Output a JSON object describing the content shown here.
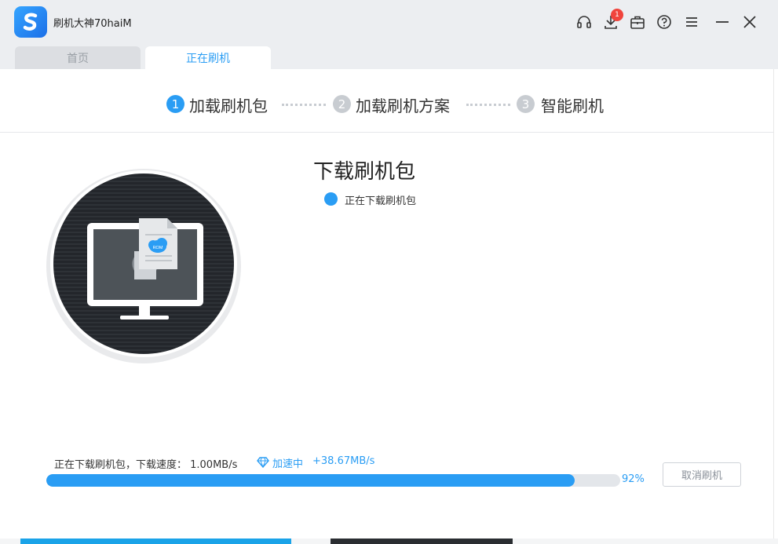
{
  "app": {
    "title": "刷机大神70haiM"
  },
  "window_controls": {
    "download_badge": "1"
  },
  "tabs": [
    {
      "label": "首页"
    },
    {
      "label": "正在刷机"
    }
  ],
  "steps": [
    {
      "num": "1",
      "label": "加载刷机包"
    },
    {
      "num": "2",
      "label": "加载刷机方案"
    },
    {
      "num": "3",
      "label": "智能刷机"
    }
  ],
  "main": {
    "title": "下载刷机包",
    "status": "正在下载刷机包",
    "illustration_text": "ROM"
  },
  "progress": {
    "info": "正在下载刷机包，下载速度： 1.00MB/s",
    "accel_label": "加速中",
    "accel_speed": "+38.67MB/s",
    "percent_label": "92%",
    "percent": 92,
    "cancel_label": "取消刷机"
  },
  "colors": {
    "accent": "#2a9df4",
    "step_inactive": "#c8ccd1",
    "badge": "#f0443c"
  }
}
